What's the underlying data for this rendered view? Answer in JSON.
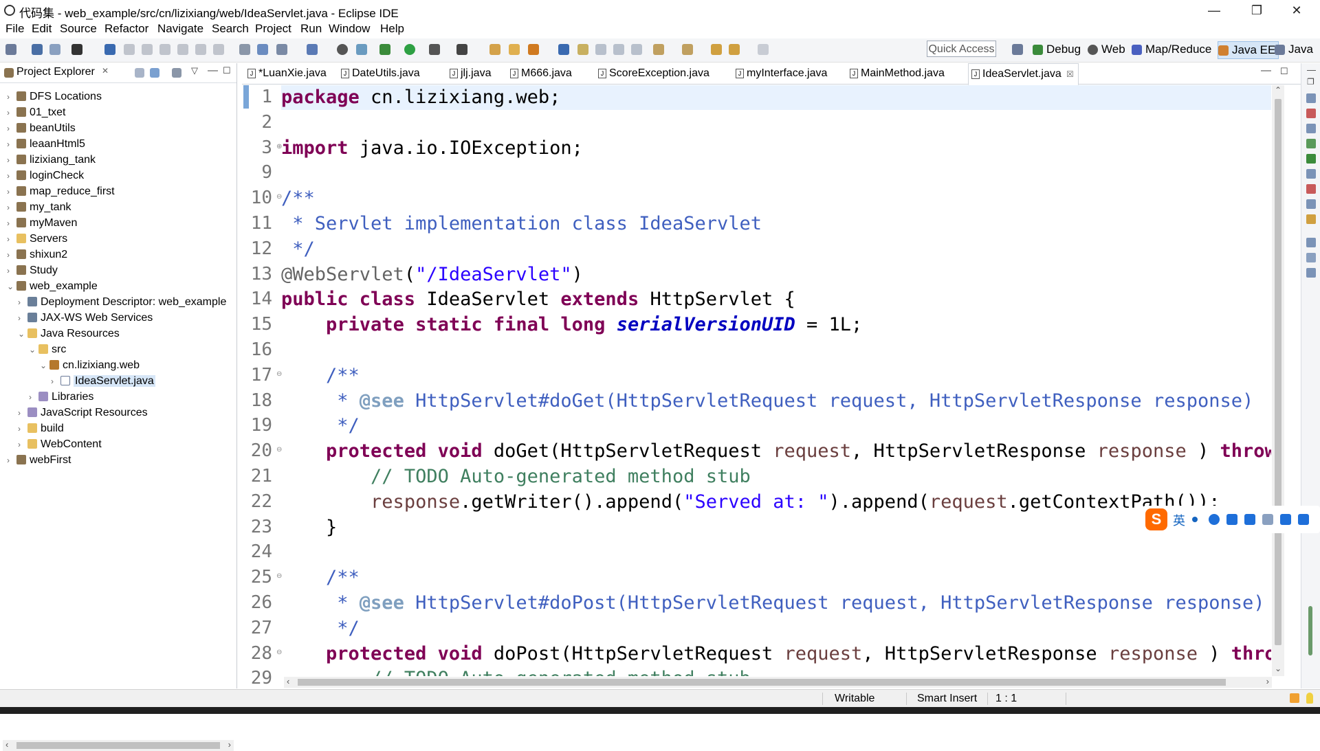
{
  "window": {
    "title": "代码集 - web_example/src/cn/lizixiang/web/IdeaServlet.java - Eclipse IDE",
    "minimize": "—",
    "restore": "❐",
    "close": "✕"
  },
  "menu": [
    "File",
    "Edit",
    "Source",
    "Refactor",
    "Navigate",
    "Search",
    "Project",
    "Run",
    "Window",
    "Help"
  ],
  "toolbar": {
    "quick_access": "Quick Access",
    "perspectives": [
      "Debug",
      "Web",
      "Map/Reduce",
      "Java EE",
      "Java"
    ],
    "active_perspective": "Java EE"
  },
  "explorer": {
    "title": "Project Explorer",
    "items": [
      {
        "label": "DFS Locations",
        "indent": 0,
        "twisty": "›",
        "icon": "dfs"
      },
      {
        "label": "01_txet",
        "indent": 0,
        "twisty": "›",
        "icon": "proj"
      },
      {
        "label": "beanUtils",
        "indent": 0,
        "twisty": "›",
        "icon": "proj"
      },
      {
        "label": "leaanHtml5",
        "indent": 0,
        "twisty": "›",
        "icon": "proj"
      },
      {
        "label": "lizixiang_tank",
        "indent": 0,
        "twisty": "›",
        "icon": "proj"
      },
      {
        "label": "loginCheck",
        "indent": 0,
        "twisty": "›",
        "icon": "proj"
      },
      {
        "label": "map_reduce_first",
        "indent": 0,
        "twisty": "›",
        "icon": "proj"
      },
      {
        "label": "my_tank",
        "indent": 0,
        "twisty": "›",
        "icon": "proj"
      },
      {
        "label": "myMaven",
        "indent": 0,
        "twisty": "›",
        "icon": "proj"
      },
      {
        "label": "Servers",
        "indent": 0,
        "twisty": "›",
        "icon": "folder"
      },
      {
        "label": "shixun2",
        "indent": 0,
        "twisty": "›",
        "icon": "proj"
      },
      {
        "label": "Study",
        "indent": 0,
        "twisty": "›",
        "icon": "proj"
      },
      {
        "label": "web_example",
        "indent": 0,
        "twisty": "⌄",
        "icon": "proj"
      },
      {
        "label": "Deployment Descriptor: web_example",
        "indent": 1,
        "twisty": "›",
        "icon": "gear"
      },
      {
        "label": "JAX-WS Web Services",
        "indent": 1,
        "twisty": "›",
        "icon": "gear"
      },
      {
        "label": "Java Resources",
        "indent": 1,
        "twisty": "⌄",
        "icon": "folder"
      },
      {
        "label": "src",
        "indent": 2,
        "twisty": "⌄",
        "icon": "folder"
      },
      {
        "label": "cn.lizixiang.web",
        "indent": 3,
        "twisty": "⌄",
        "icon": "pkg"
      },
      {
        "label": "IdeaServlet.java",
        "indent": 4,
        "twisty": "›",
        "icon": "java",
        "selected": true
      },
      {
        "label": "Libraries",
        "indent": 2,
        "twisty": "›",
        "icon": "lib"
      },
      {
        "label": "JavaScript Resources",
        "indent": 1,
        "twisty": "›",
        "icon": "lib"
      },
      {
        "label": "build",
        "indent": 1,
        "twisty": "›",
        "icon": "folder"
      },
      {
        "label": "WebContent",
        "indent": 1,
        "twisty": "›",
        "icon": "folder"
      },
      {
        "label": "webFirst",
        "indent": 0,
        "twisty": "›",
        "icon": "proj"
      }
    ]
  },
  "tabs": [
    {
      "label": "*LuanXie.java"
    },
    {
      "label": "DateUtils.java"
    },
    {
      "label": "jlj.java"
    },
    {
      "label": "M666.java"
    },
    {
      "label": "ScoreException.java"
    },
    {
      "label": "myInterface.java"
    },
    {
      "label": "MainMethod.java"
    },
    {
      "label": "IdeaServlet.java",
      "active": true
    }
  ],
  "tab_close": "☒",
  "code": {
    "line_numbers": [
      "1",
      "2",
      "3",
      "9",
      "10",
      "11",
      "12",
      "13",
      "14",
      "15",
      "16",
      "17",
      "18",
      "19",
      "20",
      "21",
      "22",
      "23",
      "24",
      "25",
      "26",
      "27",
      "28",
      "29"
    ],
    "lines": [
      [
        [
          "kw",
          "package"
        ],
        [
          "",
          "cn.lizixiang.web;"
        ]
      ],
      [],
      [
        [
          "kw",
          "import"
        ],
        [
          "",
          "java.io.IOException;"
        ]
      ],
      [],
      [
        [
          "jd",
          "/**"
        ]
      ],
      [
        [
          "jd",
          " * Servlet implementation class IdeaServlet"
        ]
      ],
      [
        [
          "jd",
          " */"
        ]
      ],
      [
        [
          "ann",
          "@WebServlet"
        ],
        [
          "",
          "("
        ],
        [
          "st",
          "\"/IdeaServlet\""
        ],
        [
          "",
          ")"
        ]
      ],
      [
        [
          "kw",
          "public class"
        ],
        [
          "",
          " IdeaServlet "
        ],
        [
          "kw",
          "extends"
        ],
        [
          "",
          " HttpServlet {"
        ]
      ],
      [
        [
          "",
          "    "
        ],
        [
          "kw",
          "private static final long"
        ],
        [
          "",
          " "
        ],
        [
          "fld",
          "serialVersionUID"
        ],
        [
          "",
          " = 1L;"
        ]
      ],
      [],
      [
        [
          "",
          "    "
        ],
        [
          "jd",
          "/**"
        ]
      ],
      [
        [
          "",
          "     "
        ],
        [
          "jd",
          "* "
        ],
        [
          "jt",
          "@see"
        ],
        [
          "jd",
          " HttpServlet#doGet(HttpServletRequest request, HttpServletResponse response)"
        ]
      ],
      [
        [
          "",
          "     "
        ],
        [
          "jd",
          "*/"
        ]
      ],
      [
        [
          "",
          "    "
        ],
        [
          "kw",
          "protected void"
        ],
        [
          "",
          " doGet(HttpServletRequest "
        ],
        [
          "prm",
          "request"
        ],
        [
          "",
          ", HttpServletResponse "
        ],
        [
          "prm",
          "response"
        ],
        [
          "",
          " ) "
        ],
        [
          "kw",
          "throws"
        ]
      ],
      [
        [
          "",
          "        "
        ],
        [
          "cm",
          "// TODO Auto-generated method stub"
        ]
      ],
      [
        [
          "",
          "        "
        ],
        [
          "prm",
          "response"
        ],
        [
          "",
          ".getWriter().append("
        ],
        [
          "st",
          "\"Served at: \""
        ],
        [
          "",
          ").append("
        ],
        [
          "prm",
          "request"
        ],
        [
          "",
          ".getContextPath());"
        ]
      ],
      [
        [
          "",
          "    }"
        ]
      ],
      [],
      [
        [
          "",
          "    "
        ],
        [
          "jd",
          "/**"
        ]
      ],
      [
        [
          "",
          "     "
        ],
        [
          "jd",
          "* "
        ],
        [
          "jt",
          "@see"
        ],
        [
          "jd",
          " HttpServlet#doPost(HttpServletRequest request, HttpServletResponse response)"
        ]
      ],
      [
        [
          "",
          "     "
        ],
        [
          "jd",
          "*/"
        ]
      ],
      [
        [
          "",
          "    "
        ],
        [
          "kw",
          "protected void"
        ],
        [
          "",
          " doPost(HttpServletRequest "
        ],
        [
          "prm",
          "request"
        ],
        [
          "",
          ", HttpServletResponse "
        ],
        [
          "prm",
          "response"
        ],
        [
          "",
          " ) "
        ],
        [
          "kw",
          "throws"
        ]
      ],
      [
        [
          "",
          "        "
        ],
        [
          "cm",
          "// TODO Auto-generated method stub"
        ]
      ]
    ]
  },
  "status": {
    "writable": "Writable",
    "insert_mode": "Smart Insert",
    "position": "1 : 1"
  },
  "ime": {
    "logo": "S",
    "lang": "英"
  }
}
